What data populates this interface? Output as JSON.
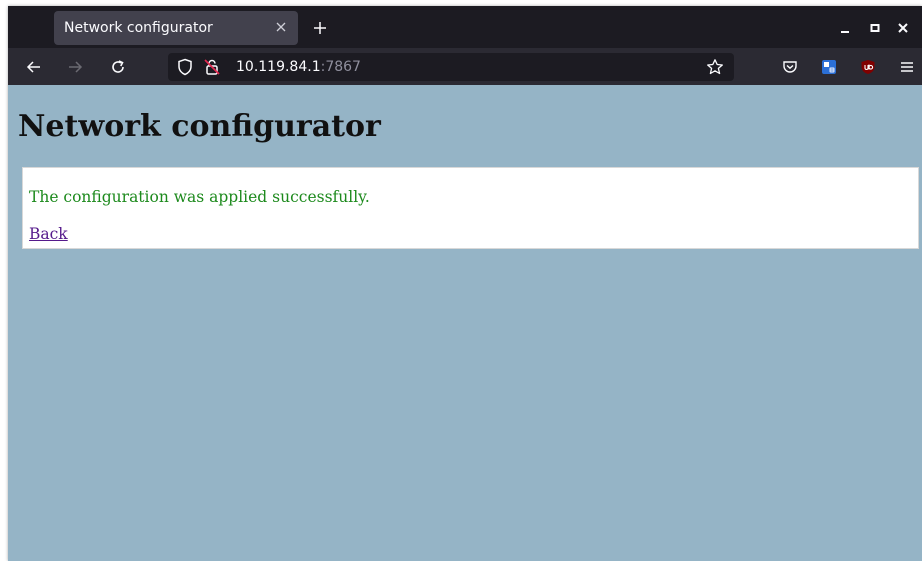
{
  "browser": {
    "tab": {
      "title": "Network configurator"
    },
    "address_bar": {
      "host": "10.119.84.1",
      "port": ":7867"
    }
  },
  "page": {
    "heading": "Network configurator",
    "message": "The configuration was applied successfully.",
    "back_link": "Back"
  },
  "icons": {
    "tab_close": "close-icon",
    "new_tab": "plus-icon",
    "back": "arrow-left-icon",
    "forward": "arrow-right-icon",
    "reload": "reload-icon",
    "shield": "shield-icon",
    "insecure": "insecure-lock-icon",
    "bookmark": "star-icon",
    "pocket": "pocket-icon",
    "extension_1": "extension-icon",
    "extension_ublock": "ublock-icon",
    "menu": "hamburger-menu-icon",
    "minimize": "minimize-icon",
    "maximize": "maximize-icon",
    "close_window": "close-window-icon"
  },
  "colors": {
    "page_background": "#95b4c6",
    "success_text": "#1d8a1d",
    "visited_link": "#551a8b",
    "tabbar": "#1c1b22",
    "toolbar": "#2b2a33"
  }
}
